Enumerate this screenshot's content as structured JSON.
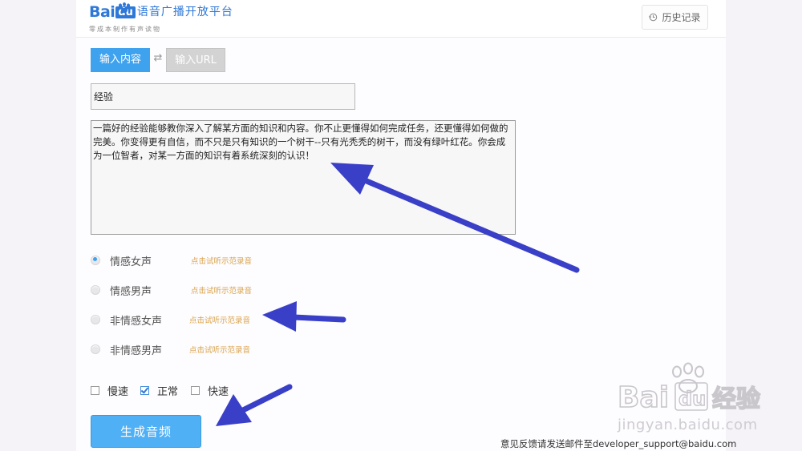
{
  "header": {
    "logo_bai": "Bai",
    "logo_du": "du",
    "logo_name": "语音广播开放平台",
    "logo_sub": "零成本制作有声读物",
    "history_label": "历史记录"
  },
  "tabs": {
    "content_label": "输入内容",
    "url_label": "输入URL",
    "swap_icon": "swap-icon"
  },
  "form": {
    "title_value": "经验",
    "content_value": "一篇好的经验能够教你深入了解某方面的知识和内容。你不止更懂得如何完成任务，还更懂得如何做的完美。你变得更有自信，而不只是只有知识的一个树干--只有光秃秃的树干，而没有绿叶红花。你会成为一位智者，对某一方面的知识有着系统深刻的认识！"
  },
  "voices": [
    {
      "label": "情感女声",
      "link": "点击试听示范录音",
      "selected": true
    },
    {
      "label": "情感男声",
      "link": "点击试听示范录音",
      "selected": false
    },
    {
      "label": "非情感女声",
      "link": "点击试听示范录音",
      "selected": false
    },
    {
      "label": "非情感男声",
      "link": "点击试听示范录音",
      "selected": false
    }
  ],
  "speeds": [
    {
      "label": "慢速",
      "checked": false
    },
    {
      "label": "正常",
      "checked": true
    },
    {
      "label": "快速",
      "checked": false
    }
  ],
  "generate_label": "生成音频",
  "feedback": "意见反馈请发送邮件至developer_support@baidu.com",
  "watermark": {
    "bai": "Bai",
    "du": "du",
    "jingyan": "经验",
    "url": "jingyan.baidu.com"
  },
  "colors": {
    "accent": "#3fa2ee",
    "brand": "#2e78d8",
    "link": "#d9a24a",
    "annotation_arrow": "#3a3fc8"
  }
}
